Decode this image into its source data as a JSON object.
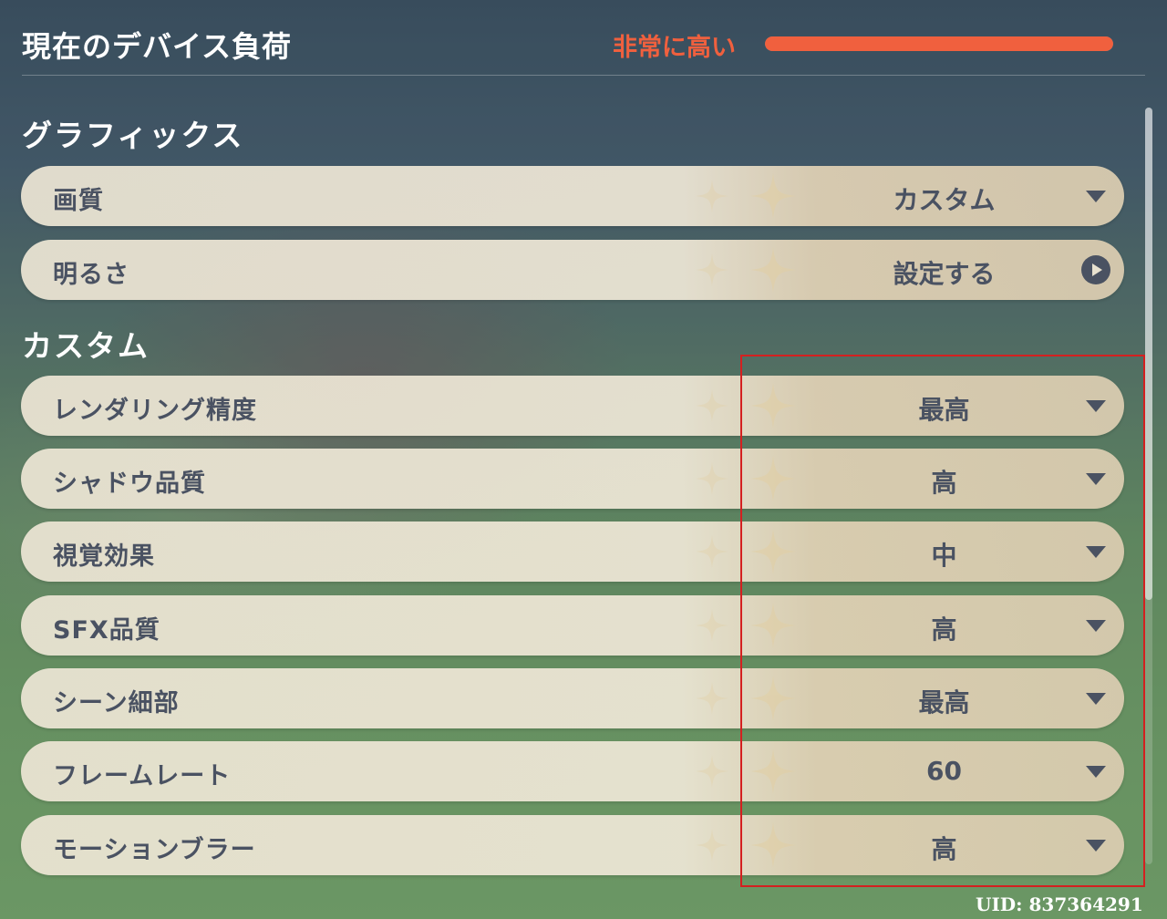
{
  "header": {
    "title": "現在のデバイス負荷",
    "load_label": "非常に高い",
    "load_level_percent": 100,
    "load_color": "#f0603e"
  },
  "graphics": {
    "section_title": "グラフィックス",
    "items": [
      {
        "label": "画質",
        "value": "カスタム",
        "control": "dropdown"
      },
      {
        "label": "明るさ",
        "value": "設定する",
        "control": "navigate"
      }
    ]
  },
  "custom": {
    "section_title": "カスタム",
    "items": [
      {
        "label": "レンダリング精度",
        "value": "最高",
        "control": "dropdown"
      },
      {
        "label": "シャドウ品質",
        "value": "高",
        "control": "dropdown"
      },
      {
        "label": "視覚効果",
        "value": "中",
        "control": "dropdown"
      },
      {
        "label": "SFX品質",
        "value": "高",
        "control": "dropdown"
      },
      {
        "label": "シーン細部",
        "value": "最高",
        "control": "dropdown"
      },
      {
        "label": "フレームレート",
        "value": "60",
        "control": "dropdown"
      },
      {
        "label": "モーションブラー",
        "value": "高",
        "control": "dropdown"
      }
    ]
  },
  "footer": {
    "uid": "UID: 837364291"
  },
  "annotation": {
    "highlight_color": "#d42020"
  }
}
